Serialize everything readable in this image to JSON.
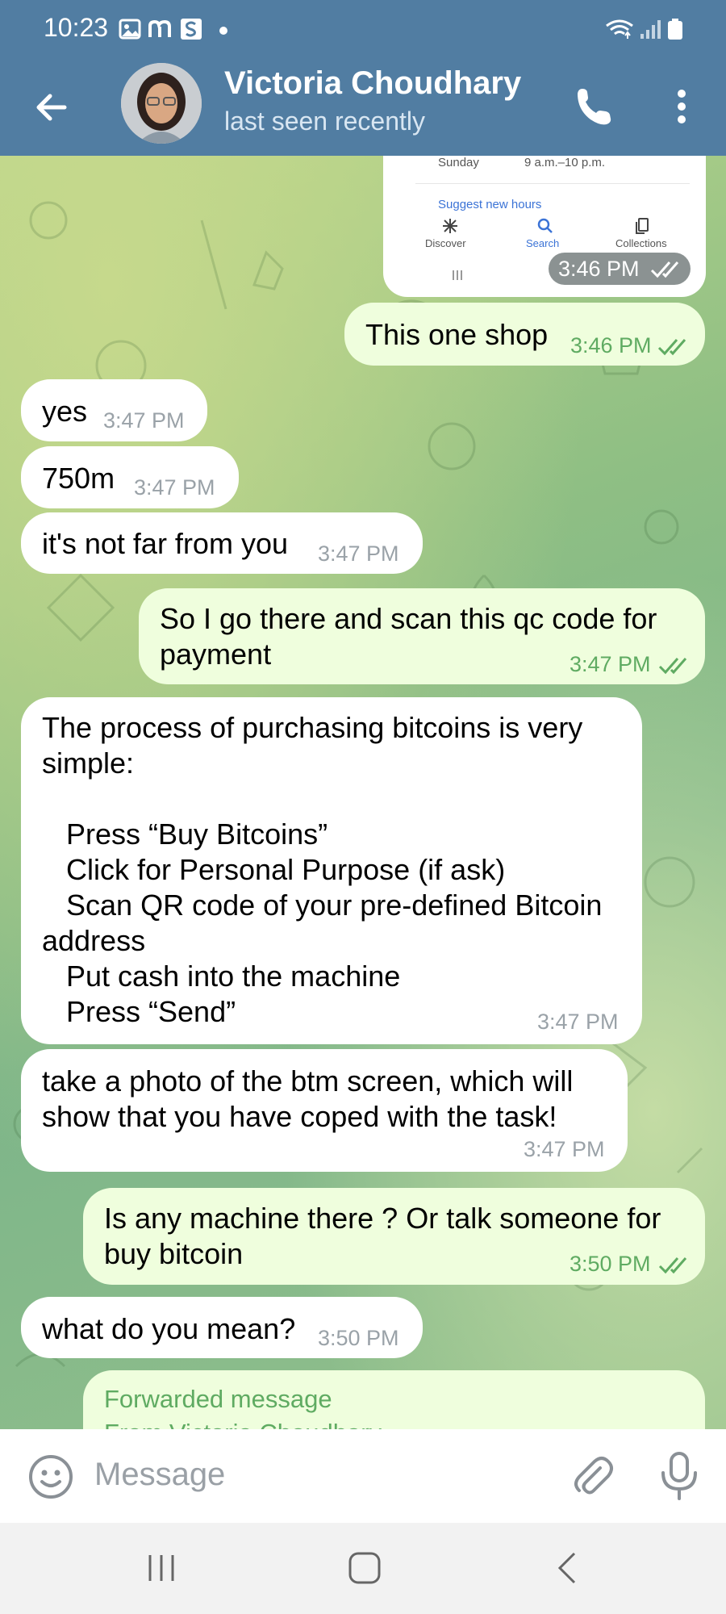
{
  "status_bar": {
    "time": "10:23",
    "icons": [
      "gallery-icon",
      "m-app-icon",
      "s-app-icon",
      "dot-icon",
      "wifi-icon",
      "signal-icon",
      "battery-icon"
    ]
  },
  "header": {
    "name": "Victoria Choudhary",
    "status": "last seen recently",
    "colors": {
      "bar": "#517da2",
      "text": "#ffffff"
    }
  },
  "screenshot_card": {
    "day": "Sunday",
    "hours": "9 a.m.–10 p.m.",
    "suggest": "Suggest new hours",
    "tabs": [
      "Discover",
      "Search",
      "Collections"
    ],
    "time": "3:46 PM"
  },
  "messages": [
    {
      "dir": "out",
      "text": "This one shop",
      "time": "3:46 PM"
    },
    {
      "dir": "in",
      "text": "yes",
      "time": "3:47 PM"
    },
    {
      "dir": "in",
      "text": "750m",
      "time": "3:47 PM"
    },
    {
      "dir": "in",
      "text": "it's not far from you",
      "time": "3:47 PM"
    },
    {
      "dir": "out",
      "text": "So I go there and scan this qc code for\npayment",
      "time": "3:47 PM"
    },
    {
      "dir": "in",
      "text": "The process of purchasing bitcoins is very\nsimple:\n\n   Press “Buy Bitcoins”\n   Click for Personal Purpose (if ask)\n   Scan QR code of your pre-defined Bitcoin\naddress\n   Put cash into the machine\n   Press “Send”",
      "time": "3:47 PM"
    },
    {
      "dir": "in",
      "text": "take a photo of the btm screen, which will\nshow that you have coped with the task!",
      "time": "3:47 PM"
    },
    {
      "dir": "out",
      "text": "Is any machine there ? Or talk someone for\nbuy bitcoin",
      "time": "3:50 PM"
    },
    {
      "dir": "in",
      "text": "what do you mean?",
      "time": "3:50 PM"
    }
  ],
  "forwarded": {
    "label": "Forwarded message",
    "from": "From Victoria Choudhary"
  },
  "input": {
    "placeholder": "Message"
  },
  "colors": {
    "incoming": "#ffffff",
    "outgoing": "#effedd",
    "out_time": "#5fab62",
    "in_time": "#9aa2a8"
  }
}
